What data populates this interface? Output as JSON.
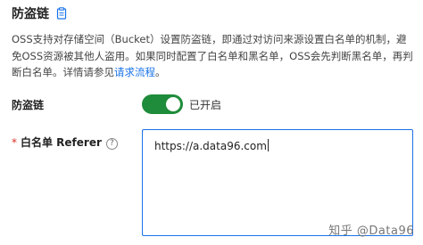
{
  "section": {
    "title": "防盗链",
    "description_prefix": "OSS支持对存储空间（Bucket）设置防盗链，即通过对访问来源设置白名单的机制，避免OSS资源被其他人盗用。如果同时配置了白名单和黑名单，OSS会先判断黑名单，再判断白名单。详情请参见",
    "description_link": "请求流程",
    "description_suffix": "。"
  },
  "hotlink": {
    "label": "防盗链",
    "toggle_on": true,
    "status": "已开启"
  },
  "whitelist": {
    "required_mark": "*",
    "label": "白名单 Referer",
    "help_glyph": "?",
    "value": "https://a.data96.com"
  },
  "watermark": "知乎 @Data96",
  "icons": [
    "copy-icon",
    "help-icon"
  ],
  "colors": {
    "accent": "#1a73e8",
    "toggle": "#1e8c3a",
    "required": "#d93026"
  }
}
